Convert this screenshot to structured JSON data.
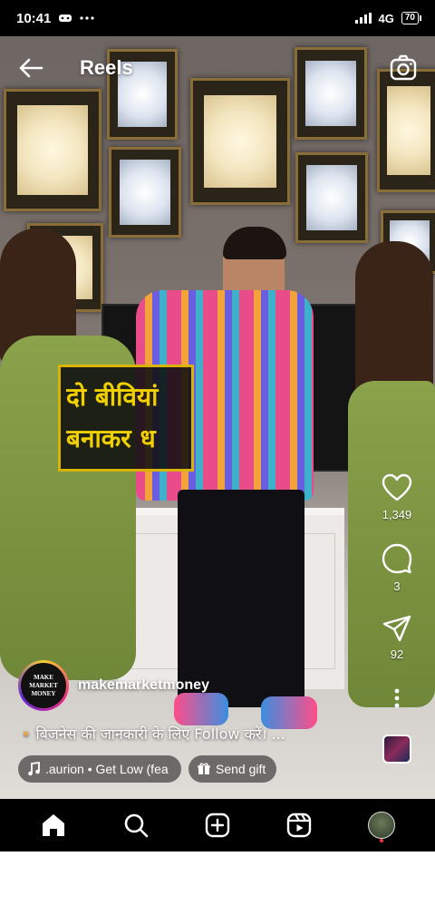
{
  "status_bar": {
    "time": "10:41",
    "network": "4G",
    "battery": "70"
  },
  "header": {
    "title": "Reels"
  },
  "video": {
    "overlay_line1": "दो बीवियां",
    "overlay_line2": "बनाकर ध"
  },
  "actions": {
    "likes": "1,349",
    "comments": "3",
    "shares": "92"
  },
  "author": {
    "username": "makemarketmoney",
    "avatar_line1": "MAKE",
    "avatar_line2": "MARKET",
    "avatar_line3": "MONEY"
  },
  "caption": {
    "text": "बिजनेस की जानकारी के लिए Follow करें। ..."
  },
  "chips": {
    "audio_label": ".aurion • Get Low (fea",
    "gift_label": "Send gift"
  },
  "colors": {
    "like_badge": "#ff3040",
    "overlay_text": "#f2d000",
    "overlay_border": "#d8b400"
  },
  "icons": [
    "back-arrow-icon",
    "camera-icon",
    "heart-icon",
    "comment-icon",
    "share-icon",
    "more-icon",
    "music-note-icon",
    "gift-icon",
    "home-icon",
    "search-icon",
    "create-icon",
    "reels-icon"
  ]
}
